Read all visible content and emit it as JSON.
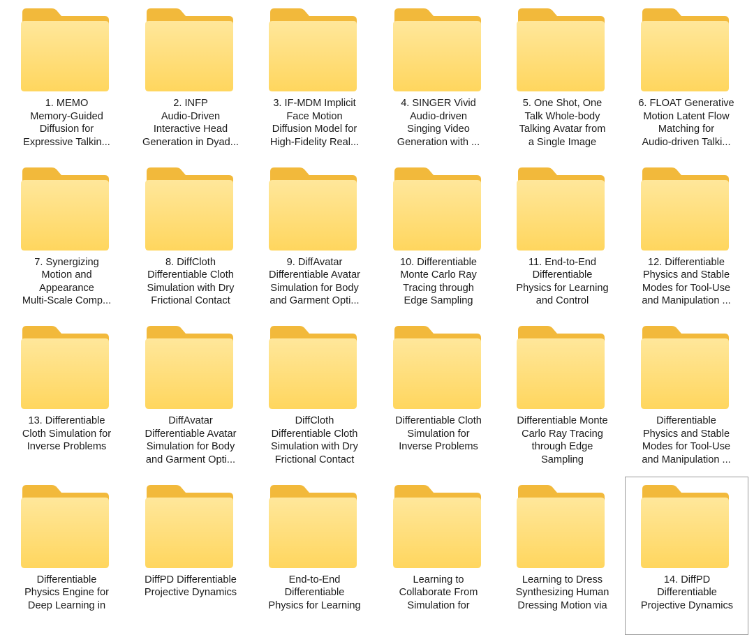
{
  "folders": [
    {
      "name": "1. MEMO\nMemory-Guided\nDiffusion for\nExpressive Talkin..."
    },
    {
      "name": "2. INFP\nAudio-Driven\nInteractive Head\nGeneration in Dyad..."
    },
    {
      "name": "3. IF-MDM Implicit\nFace Motion\nDiffusion Model for\nHigh-Fidelity Real..."
    },
    {
      "name": "4. SINGER Vivid\nAudio-driven\nSinging Video\nGeneration with ..."
    },
    {
      "name": "5. One Shot, One\nTalk Whole-body\nTalking Avatar from\na Single Image"
    },
    {
      "name": "6. FLOAT Generative\nMotion Latent Flow\nMatching for\nAudio-driven Talki..."
    },
    {
      "name": "7. Synergizing\nMotion and\nAppearance\nMulti-Scale Comp..."
    },
    {
      "name": "8. DiffCloth\nDifferentiable Cloth\nSimulation with Dry\nFrictional Contact"
    },
    {
      "name": "9. DiffAvatar\nDifferentiable Avatar\nSimulation for Body\nand Garment Opti..."
    },
    {
      "name": "10. Differentiable\nMonte Carlo Ray\nTracing through\nEdge Sampling"
    },
    {
      "name": "11. End-to-End\nDifferentiable\nPhysics for Learning\nand Control"
    },
    {
      "name": "12. Differentiable\nPhysics and Stable\nModes for Tool-Use\nand Manipulation ..."
    },
    {
      "name": "13. Differentiable\nCloth Simulation for\nInverse Problems"
    },
    {
      "name": "DiffAvatar\nDifferentiable Avatar\nSimulation for Body\nand Garment Opti..."
    },
    {
      "name": "DiffCloth\nDifferentiable Cloth\nSimulation with Dry\nFrictional Contact"
    },
    {
      "name": "Differentiable Cloth\nSimulation for\nInverse Problems"
    },
    {
      "name": "Differentiable Monte\nCarlo Ray Tracing\nthrough Edge\nSampling"
    },
    {
      "name": "Differentiable\nPhysics and Stable\nModes for Tool-Use\nand Manipulation ..."
    },
    {
      "name": "Differentiable\nPhysics Engine for\nDeep Learning in"
    },
    {
      "name": "DiffPD Differentiable\nProjective Dynamics"
    },
    {
      "name": "End-to-End\nDifferentiable\nPhysics for Learning"
    },
    {
      "name": "Learning to\nCollaborate From\nSimulation for"
    },
    {
      "name": "Learning to Dress\nSynthesizing Human\nDressing Motion via"
    },
    {
      "name": "14. DiffPD\nDifferentiable\nProjective Dynamics",
      "selected": true
    }
  ],
  "colors": {
    "folder_back": "#F2B93B",
    "folder_front_top": "#FFE79B",
    "folder_front_bottom": "#FFD65E",
    "selection_border": "#999999",
    "label_text": "#1A1A1A"
  },
  "icon": "folder-icon"
}
